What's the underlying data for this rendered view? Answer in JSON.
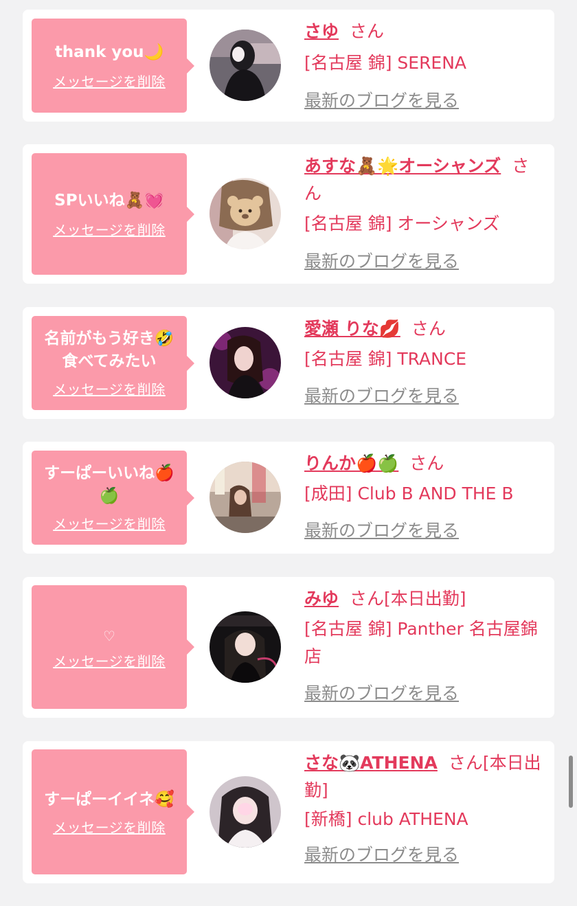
{
  "items": [
    {
      "message": "thank you🌙",
      "delete_label": "メッセージを削除",
      "name": "さゆ",
      "suffix": "さん",
      "status": "",
      "shop": "[名古屋 錦] SERENA",
      "blog_label": "最新のブログを見る"
    },
    {
      "message": "SPいいね🧸💓",
      "delete_label": "メッセージを削除",
      "name": "あすな🧸🌟オーシャンズ",
      "suffix": "さん",
      "status": "",
      "shop": "[名古屋 錦] オーシャンズ",
      "blog_label": "最新のブログを見る"
    },
    {
      "message": "名前がもう好き🤣\n食べてみたい",
      "delete_label": "メッセージを削除",
      "name": "愛瀬 りな💋",
      "suffix": "さん",
      "status": "",
      "shop": "[名古屋 錦] TRANCE",
      "blog_label": "最新のブログを見る"
    },
    {
      "message": "すーぱーいいね🍎🍏",
      "delete_label": "メッセージを削除",
      "name": "りんか🍎🍏",
      "suffix": "さん",
      "status": "",
      "shop": "[成田] Club B AND THE B",
      "blog_label": "最新のブログを見る"
    },
    {
      "message": "♡",
      "delete_label": "メッセージを削除",
      "name": "みゆ",
      "suffix": "さん",
      "status": "[本日出勤]",
      "shop": "[名古屋 錦] Panther 名古屋錦店",
      "blog_label": "最新のブログを見る"
    },
    {
      "message": "すーぱーイイネ🥰",
      "delete_label": "メッセージを削除",
      "name": "さな🐼ATHENA",
      "suffix": "さん",
      "status": "[本日出勤]",
      "shop": "[新橋] club ATHENA",
      "blog_label": "最新のブログを見る"
    }
  ],
  "colors": {
    "page_bg": "#f2f2f3",
    "card_bg": "#ffffff",
    "bubble_bg": "#fb9aaa",
    "accent_text": "#e33a5c",
    "muted_link": "#8c8c8c"
  }
}
